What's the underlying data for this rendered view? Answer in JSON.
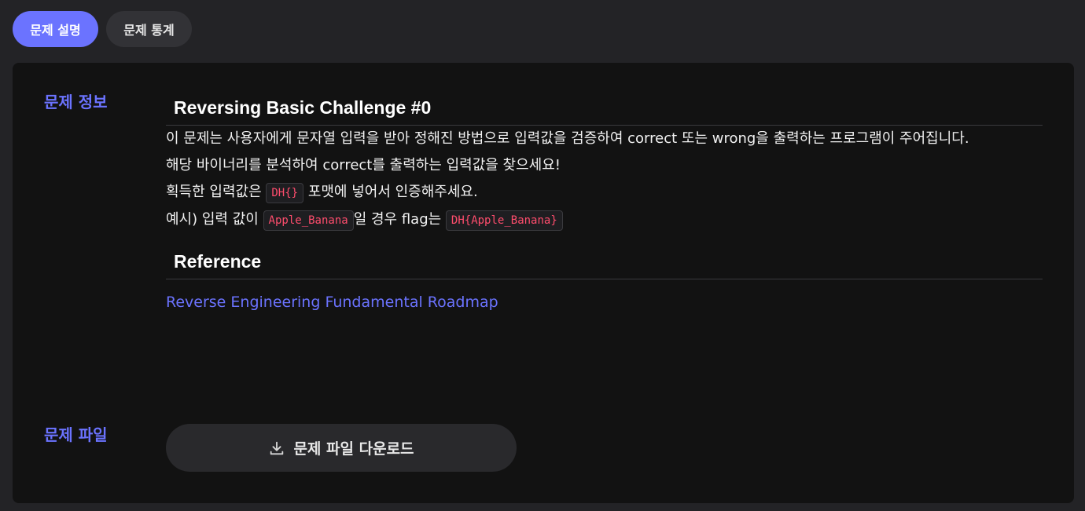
{
  "tabs": {
    "description": "문제 설명",
    "stats": "문제 통계"
  },
  "sections": {
    "info_label": "문제 정보",
    "file_label": "문제 파일"
  },
  "content": {
    "title": "Reversing Basic Challenge #0",
    "paragraph1": "이 문제는 사용자에게 문자열 입력을 받아 정해진 방법으로 입력값을 검증하여 correct 또는 wrong을 출력하는 프로그램이 주어집니다.",
    "paragraph2": "해당 바이너리를 분석하여 correct를 출력하는 입력값을 찾으세요!",
    "paragraph3": {
      "before": "획득한 입력값은 ",
      "code": "DH{}",
      "after": " 포맷에 넣어서 인증해주세요."
    },
    "paragraph4": {
      "before": "예시) 입력 값이 ",
      "code1": "Apple_Banana",
      "middle": "일 경우 flag는 ",
      "code2": "DH{Apple_Banana}"
    },
    "reference_heading": "Reference",
    "reference_link": "Reverse Engineering Fundamental Roadmap"
  },
  "download": {
    "label": "문제 파일 다운로드",
    "icon": "download-icon"
  },
  "colors": {
    "accent": "#6b73ff",
    "code_text": "#ff4d6d",
    "panel_bg": "#121212",
    "page_bg": "#232326"
  }
}
